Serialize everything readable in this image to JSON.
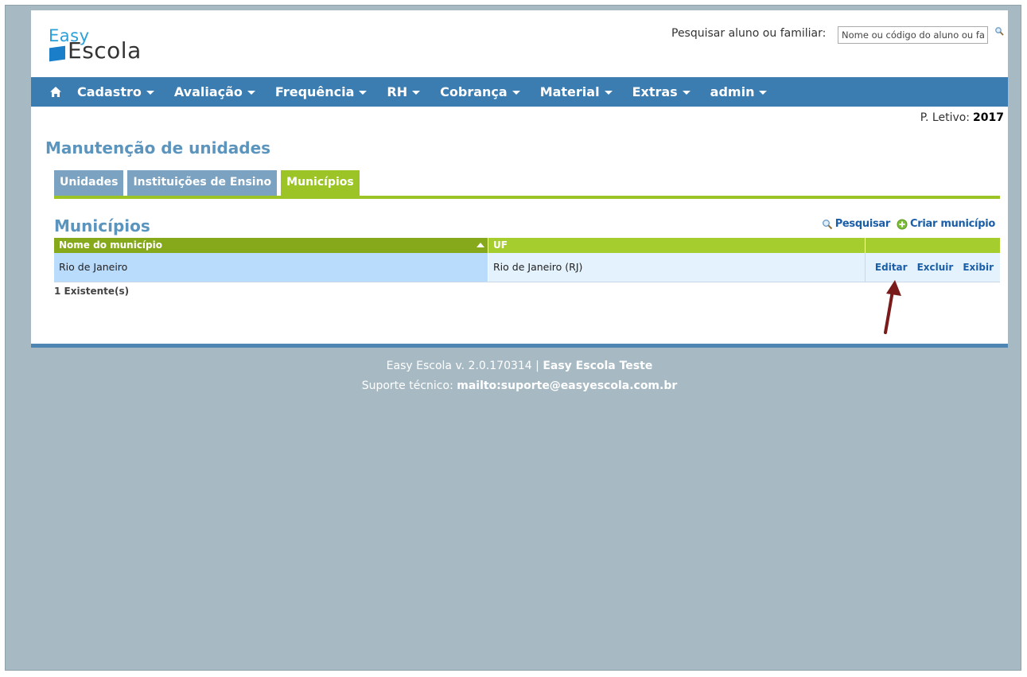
{
  "header": {
    "logo_top": "Easy",
    "logo_bottom": "Escola",
    "search_label": "Pesquisar aluno ou familiar:",
    "search_placeholder": "Nome ou código do aluno ou fa"
  },
  "nav": {
    "items": [
      {
        "label": "Cadastro"
      },
      {
        "label": "Avaliação"
      },
      {
        "label": "Frequência"
      },
      {
        "label": "RH"
      },
      {
        "label": "Cobrança"
      },
      {
        "label": "Material"
      },
      {
        "label": "Extras"
      },
      {
        "label": "admin"
      }
    ]
  },
  "periodo": {
    "label": "P. Letivo:",
    "value": "2017"
  },
  "page": {
    "title": "Manutenção de unidades"
  },
  "tabs": [
    {
      "label": "Unidades",
      "active": false
    },
    {
      "label": "Instituições de Ensino",
      "active": false
    },
    {
      "label": "Municípios",
      "active": true
    }
  ],
  "section": {
    "title": "Municípios",
    "search_action": "Pesquisar",
    "create_action": "Criar município"
  },
  "table": {
    "columns": [
      "Nome do município",
      "UF",
      ""
    ],
    "rows": [
      {
        "nome": "Rio de Janeiro",
        "uf": "Rio de Janeiro (RJ)",
        "actions": [
          "Editar",
          "Excluir",
          "Exibir"
        ]
      }
    ],
    "count_text": "1 Existente(s)"
  },
  "footer": {
    "version_text": "Easy Escola v. 2.0.170314 |",
    "instance": "Easy Escola Teste",
    "support_label": "Suporte técnico:",
    "support_link": "mailto:suporte@easyescola.com.br"
  },
  "colors": {
    "nav_bg": "#3b7cb1",
    "accent_green": "#9cc427",
    "title_blue": "#5b94bd",
    "frame_bg": "#a7b9c2"
  }
}
